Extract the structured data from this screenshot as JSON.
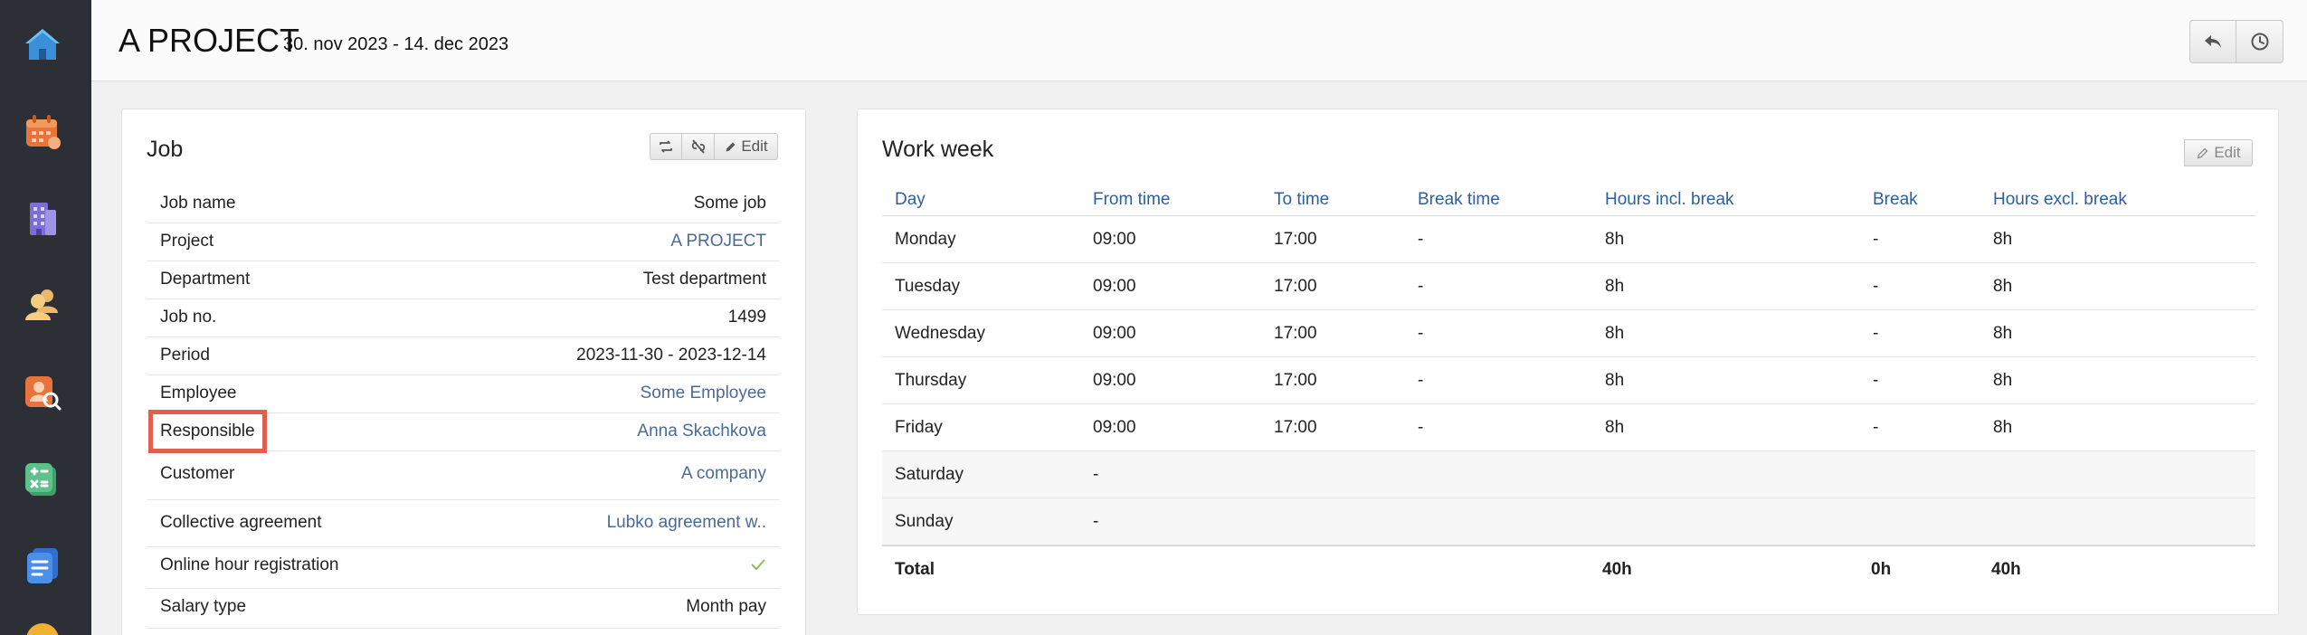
{
  "header": {
    "title": "A PROJECT",
    "dates": "30. nov 2023 - 14. dec 2023"
  },
  "sidebar": {
    "items": [
      {
        "icon": "home-icon"
      },
      {
        "icon": "calendar-icon"
      },
      {
        "icon": "building-icon"
      },
      {
        "icon": "employees-icon"
      },
      {
        "icon": "employee-search-icon"
      },
      {
        "icon": "calculator-icon"
      },
      {
        "icon": "documents-icon"
      }
    ]
  },
  "job": {
    "title": "Job",
    "edit_label": "Edit",
    "rows": [
      {
        "label": "Job name",
        "value": "Some job",
        "link": false
      },
      {
        "label": "Project",
        "value": "A PROJECT",
        "link": true
      },
      {
        "label": "Department",
        "value": "Test department",
        "link": false
      },
      {
        "label": "Job no.",
        "value": "1499",
        "link": false
      },
      {
        "label": "Period",
        "value": "2023-11-30 - 2023-12-14",
        "link": false
      },
      {
        "label": "Employee",
        "value": "Some Employee",
        "link": true
      },
      {
        "label": "Responsible",
        "value": "Anna Skachkova",
        "link": true
      },
      {
        "label": "Customer",
        "value": "A company",
        "link": true
      },
      {
        "label": "Collective agreement",
        "value": "Lubko agreement w..",
        "link": true
      },
      {
        "label": "Online hour registration",
        "value": "",
        "link": false
      },
      {
        "label": "Salary type",
        "value": "Month pay",
        "link": false
      }
    ]
  },
  "week": {
    "title": "Work week",
    "edit_label": "Edit",
    "columns": [
      "Day",
      "From time",
      "To time",
      "Break time",
      "Hours incl. break",
      "Break",
      "Hours excl. break"
    ],
    "rows": [
      [
        "Monday",
        "09:00",
        "17:00",
        "-",
        "8h",
        "-",
        "8h"
      ],
      [
        "Tuesday",
        "09:00",
        "17:00",
        "-",
        "8h",
        "-",
        "8h"
      ],
      [
        "Wednesday",
        "09:00",
        "17:00",
        "-",
        "8h",
        "-",
        "8h"
      ],
      [
        "Thursday",
        "09:00",
        "17:00",
        "-",
        "8h",
        "-",
        "8h"
      ],
      [
        "Friday",
        "09:00",
        "17:00",
        "-",
        "8h",
        "-",
        "8h"
      ],
      [
        "Saturday",
        "-",
        "",
        "",
        "",
        "",
        ""
      ],
      [
        "Sunday",
        "-",
        "",
        "",
        "",
        "",
        ""
      ]
    ],
    "total": [
      "Total",
      "",
      "",
      "",
      "40h",
      "0h",
      "40h"
    ]
  },
  "colors": {
    "sidebar_bg": "#2c3036",
    "link": "#4a6a9a",
    "table_header": "#2d5fa0",
    "highlight": "#e06050",
    "check": "#8cc04b"
  }
}
